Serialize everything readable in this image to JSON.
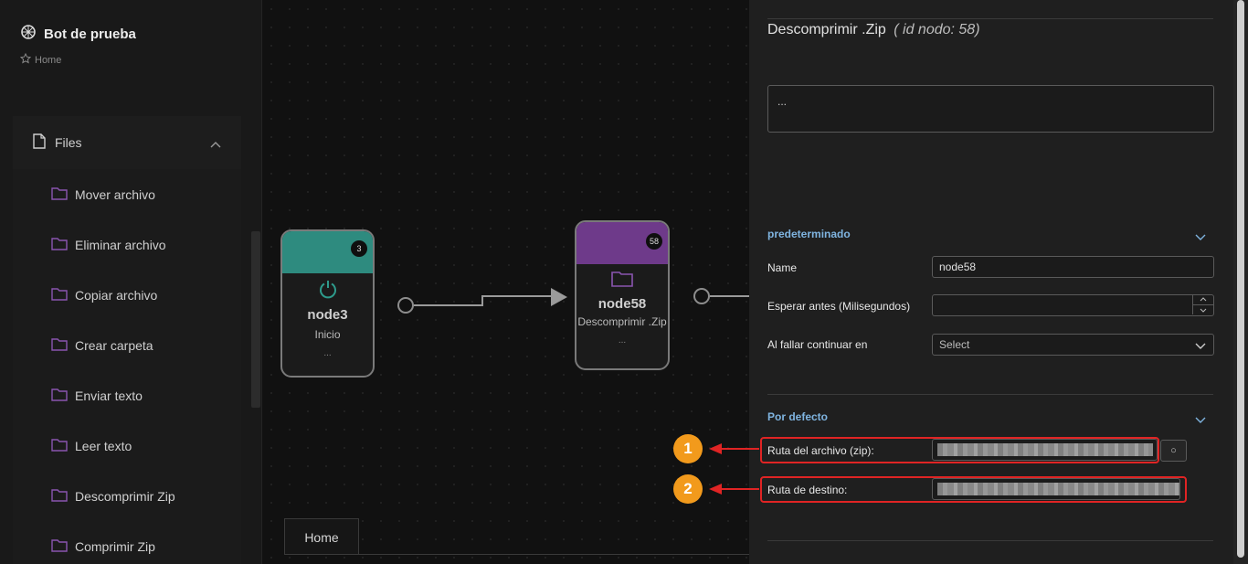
{
  "app": {
    "title": "Bot de prueba",
    "breadcrumb": "Home"
  },
  "sidebar": {
    "group": {
      "label": "Files",
      "expanded": true
    },
    "items": [
      {
        "label": "Mover archivo"
      },
      {
        "label": "Eliminar archivo"
      },
      {
        "label": "Copiar archivo"
      },
      {
        "label": "Crear carpeta"
      },
      {
        "label": "Enviar texto"
      },
      {
        "label": "Leer texto"
      },
      {
        "label": "Descomprimir Zip"
      },
      {
        "label": "Comprimir Zip"
      }
    ]
  },
  "canvas": {
    "nodes": [
      {
        "id": "3",
        "name": "node3",
        "subtitle": "Inicio",
        "dots": "...",
        "color": "#2e8b7f",
        "icon": "power-icon"
      },
      {
        "id": "58",
        "name": "node58",
        "subtitle": "Descomprimir .Zip",
        "dots": "...",
        "color": "#6e3a8a",
        "icon": "folder-icon"
      }
    ],
    "tab": "Home"
  },
  "markers": [
    "1",
    "2"
  ],
  "panel": {
    "title": "Descomprimir .Zip",
    "node_id_text": "( id nodo: 58)",
    "description": "...",
    "section1": {
      "title": "predeterminado",
      "name_label": "Name",
      "name_value": "node58",
      "wait_label": "Esperar antes (Milisegundos)",
      "wait_value": "",
      "fail_label": "Al fallar continuar en",
      "fail_value": "Select"
    },
    "section2": {
      "title": "Por defecto",
      "zip_label": "Ruta del archivo (zip):",
      "dest_label": "Ruta de destino:",
      "button_symbol": "○"
    }
  },
  "colors": {
    "accent_blue": "#7fb4e0",
    "highlight_red": "#e02424",
    "marker_orange": "#f29a1c"
  }
}
